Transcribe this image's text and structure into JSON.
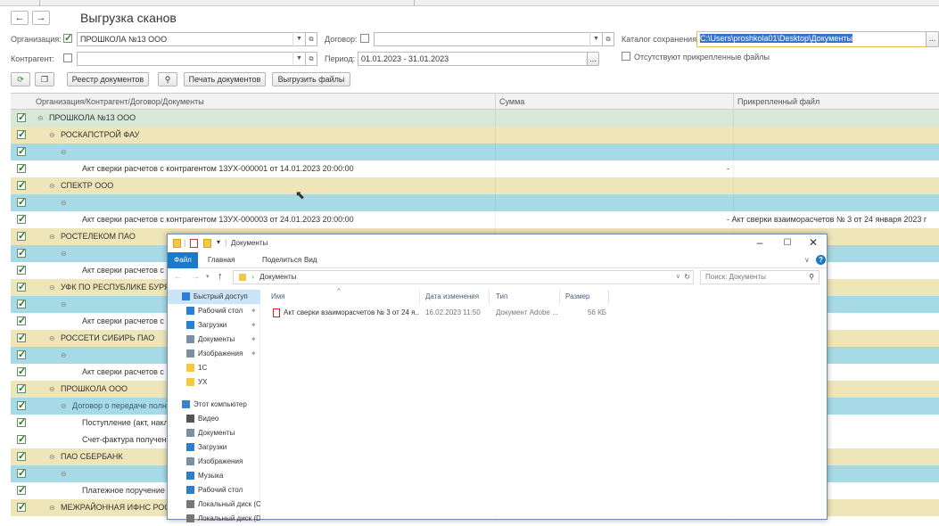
{
  "form": {
    "title": "Выгрузка сканов",
    "back_icon": "arrow-left-icon",
    "forward_icon": "arrow-right-icon",
    "org_label": "Организация:",
    "org_value": "ПРОШКОЛА №13 ООО",
    "dogovor_label": "Договор:",
    "dogovor_value": "",
    "catalog_label": "Каталог сохранения:",
    "catalog_value": "C:\\Users\\proshkola01\\Desktop\\Документы",
    "kontragent_label": "Контрагент:",
    "kontragent_value": "",
    "period_label": "Период:",
    "period_value": "01.01.2023 - 31.01.2023",
    "missing_files_label": "Отсутствуют прикрепленные файлы",
    "ellipsis": "...",
    "open_glyph": "⧉"
  },
  "toolbar": {
    "registry_label": "Реестр документов",
    "print_label": "Печать документов",
    "export_label": "Выгрузить файлы"
  },
  "grid": {
    "col_main": "Организация/Контрагент/Договор/Документы",
    "col_sum": "Сумма",
    "col_file": "Прикрепленный файл",
    "rows": [
      {
        "type": "org",
        "text": "ПРОШКОЛА №13 ООО"
      },
      {
        "type": "ka",
        "text": "РОСКАПСТРОЙ ФАУ"
      },
      {
        "type": "dog",
        "text": ""
      },
      {
        "type": "doc",
        "text": "Акт сверки расчетов с контрагентом 13УХ-000001 от 14.01.2023 20:00:00",
        "file": "-"
      },
      {
        "type": "ka",
        "text": "СПЕКТР ООО"
      },
      {
        "type": "dog",
        "text": ""
      },
      {
        "type": "doc",
        "text": "Акт сверки расчетов с контрагентом 13УХ-000003 от 24.01.2023 20:00:00",
        "file": "-   Акт сверки взаиморасчетов № 3 от 24 января 2023 г"
      },
      {
        "type": "ka",
        "text": "РОСТЕЛЕКОМ ПАО"
      },
      {
        "type": "dog",
        "text": ""
      },
      {
        "type": "doc",
        "text": "Акт сверки расчетов с к",
        "file": ""
      },
      {
        "type": "ka",
        "text": "УФК ПО РЕСПУБЛИКЕ БУРЯ"
      },
      {
        "type": "dog",
        "text": ""
      },
      {
        "type": "doc",
        "text": "Акт сверки расчетов с к",
        "file": ""
      },
      {
        "type": "ka",
        "text": "РОССЕТИ СИБИРЬ ПАО"
      },
      {
        "type": "dog",
        "text": ""
      },
      {
        "type": "doc",
        "text": "Акт сверки расчетов с к",
        "file": ""
      },
      {
        "type": "ka",
        "text": "ПРОШКОЛА ООО"
      },
      {
        "type": "dog",
        "text": "Договор о передаче полно"
      },
      {
        "type": "doc",
        "text": "Поступление (акт, накла",
        "file": ""
      },
      {
        "type": "doc",
        "text": "Счет-фактура получене",
        "file": ""
      },
      {
        "type": "ka",
        "text": "ПАО СБЕРБАНК"
      },
      {
        "type": "dog",
        "text": ""
      },
      {
        "type": "doc",
        "text": "Платежное поручение 1",
        "file": ""
      },
      {
        "type": "ka",
        "text": "МЕЖРАЙОННАЯ ИФНС РОСС"
      }
    ]
  },
  "explorer": {
    "title": "Документы",
    "tab_file": "Файл",
    "tab_home": "Главная",
    "tab_share": "Поделиться",
    "tab_view": "Вид",
    "address": "Документы",
    "search_placeholder": "Поиск: Документы",
    "col_name": "Имя",
    "col_date": "Дата изменения",
    "col_type": "Тип",
    "col_size": "Размер",
    "file": {
      "name": "Акт сверки взаиморасчетов № 3 от 24 я...",
      "date": "16.02.2023 11:50",
      "type": "Документ Adobe ...",
      "size": "56 КБ"
    },
    "nav": [
      {
        "label": "Быстрый доступ",
        "icon": "star-icon",
        "color": "#2a7fd4",
        "sel": true,
        "ind": 0
      },
      {
        "label": "Рабочий стол",
        "icon": "desktop-icon",
        "color": "#2a7fd4",
        "ind": 1
      },
      {
        "label": "Загрузки",
        "icon": "download-icon",
        "color": "#2a7fd4",
        "ind": 1
      },
      {
        "label": "Документы",
        "icon": "document-icon",
        "color": "#7d8ea5",
        "ind": 1
      },
      {
        "label": "Изображения",
        "icon": "pictures-icon",
        "color": "#7d8ea5",
        "ind": 1
      },
      {
        "label": "1С",
        "icon": "folder-icon",
        "color": "#f5c842",
        "ind": 1
      },
      {
        "label": "УХ",
        "icon": "folder-icon",
        "color": "#f5c842",
        "ind": 1
      },
      {
        "label": "Этот компьютер",
        "icon": "computer-icon",
        "color": "#3b83c8",
        "ind": 0
      },
      {
        "label": "Видео",
        "icon": "video-icon",
        "color": "#555",
        "ind": 1
      },
      {
        "label": "Документы",
        "icon": "document-icon",
        "color": "#7d8ea5",
        "ind": 1
      },
      {
        "label": "Загрузки",
        "icon": "download-icon",
        "color": "#2a7fd4",
        "ind": 1
      },
      {
        "label": "Изображения",
        "icon": "pictures-icon",
        "color": "#7d8ea5",
        "ind": 1
      },
      {
        "label": "Музыка",
        "icon": "music-icon",
        "color": "#2a7fd4",
        "ind": 1
      },
      {
        "label": "Рабочий стол",
        "icon": "desktop-icon",
        "color": "#2a7fd4",
        "ind": 1
      },
      {
        "label": "Локальный диск (C",
        "icon": "drive-icon",
        "color": "#777",
        "ind": 1
      },
      {
        "label": "Локальный диск (D",
        "icon": "drive-icon",
        "color": "#777",
        "ind": 1
      }
    ]
  }
}
